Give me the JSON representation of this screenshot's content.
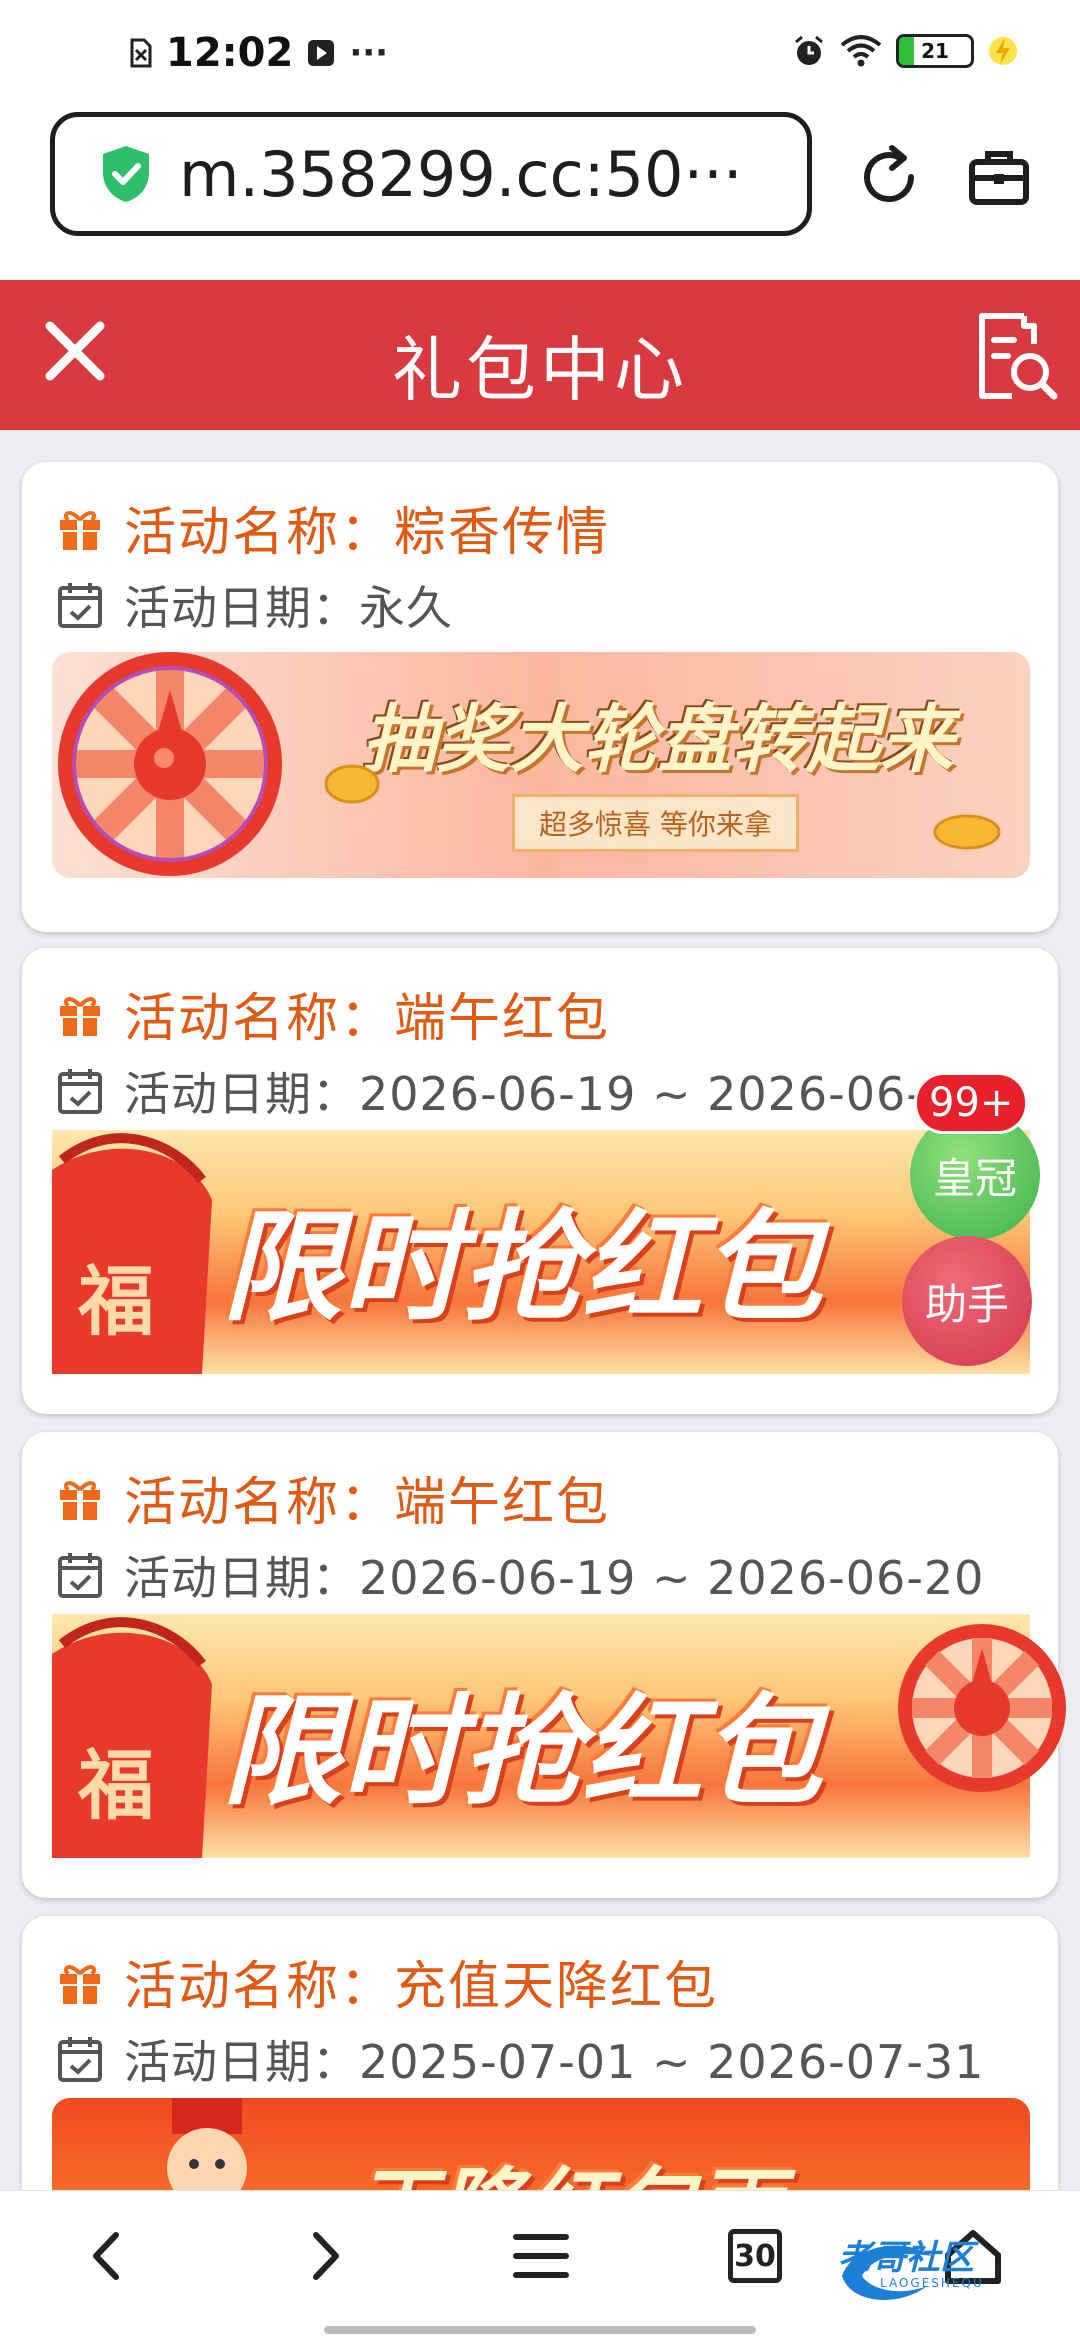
{
  "status_bar": {
    "time": "12:02",
    "dots": "···",
    "battery_level": "21",
    "battery_fraction": 0.21
  },
  "browser": {
    "url": "m.358299.cc:50···",
    "icons": [
      "shield-check-icon",
      "reload-icon",
      "toolbox-icon"
    ]
  },
  "header": {
    "title": "礼包中心",
    "icons": [
      "close-icon",
      "document-search-icon"
    ]
  },
  "activities": [
    {
      "name": "活动名称：粽香传情",
      "date": "活动日期：永久",
      "banner_text": "抽奖大轮盘转起来",
      "banner_sub": "超多惊喜 等你来拿"
    },
    {
      "name": "活动名称：端午红包",
      "date": "活动日期：2026-06-19 ~ 2026-06-20",
      "banner_text": "限时抢红包",
      "banner_fu": "福"
    },
    {
      "name": "活动名称：端午红包",
      "date": "活动日期：2026-06-19 ~ 2026-06-20",
      "banner_text": "限时抢红包",
      "banner_fu": "福"
    },
    {
      "name": "活动名称：充值天降红包",
      "date": "活动日期：2025-07-01 ~ 2026-07-31",
      "banner_text": "天降红包雨"
    }
  ],
  "floating": {
    "badge": "99+",
    "crown_label": "皇冠",
    "helper_label": "助手"
  },
  "bottom_nav": {
    "tab_count": "30",
    "icons": [
      "back-icon",
      "forward-icon",
      "menu-icon",
      "tabs-icon",
      "home-icon"
    ]
  },
  "watermark": {
    "text": "老哥社区",
    "sub": "LAOGESHEQU"
  },
  "colors": {
    "header_red": "#d93a3f",
    "title_orange": "#e05a14",
    "background": "#ececf1"
  }
}
